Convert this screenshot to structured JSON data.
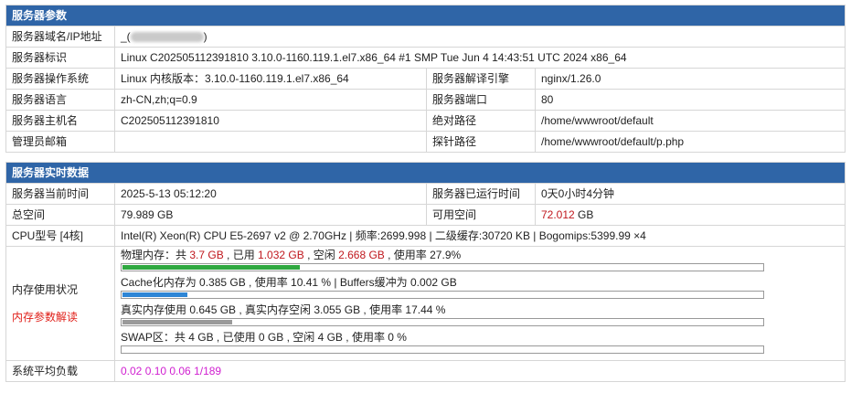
{
  "section1": {
    "title": "服务器参数",
    "rows": {
      "domain": {
        "label": "服务器域名/IP地址",
        "value_prefix": "_(",
        "value_suffix": ")"
      },
      "ident": {
        "label": "服务器标识",
        "value": "Linux C202505112391810 3.10.0-1160.119.1.el7.x86_64 #1 SMP Tue Jun 4 14:43:51 UTC 2024 x86_64"
      },
      "os": {
        "label": "服务器操作系统",
        "value": "Linux  内核版本：3.10.0-1160.119.1.el7.x86_64",
        "label2": "服务器解译引擎",
        "value2": "nginx/1.26.0"
      },
      "lang": {
        "label": "服务器语言",
        "value": "zh-CN,zh;q=0.9",
        "label2": "服务器端口",
        "value2": "80"
      },
      "host": {
        "label": "服务器主机名",
        "value": "C202505112391810",
        "label2": "绝对路径",
        "value2": "/home/wwwroot/default"
      },
      "admin": {
        "label": "管理员邮箱",
        "value": "",
        "label2": "探针路径",
        "value2": "/home/wwwroot/default/p.php"
      }
    }
  },
  "section2": {
    "title": "服务器实时数据",
    "rows": {
      "time": {
        "label": "服务器当前时间",
        "value": "2025-5-13 05:12:20",
        "label2": "服务器已运行时间",
        "value2": "0天0小时4分钟"
      },
      "space": {
        "label": "总空间",
        "value": "79.989 GB",
        "label2": "可用空间",
        "value2_num": "72.012",
        "value2_unit": " GB"
      },
      "cpu": {
        "label": "CPU型号 [4核]",
        "value": "Intel(R) Xeon(R) CPU E5-2697 v2 @ 2.70GHz | 频率:2699.998 | 二级缓存:30720 KB | Bogomips:5399.99 ×4"
      },
      "memory": {
        "label": "内存使用状况",
        "link": "内存参数解读",
        "physical": {
          "text1": "物理内存：共 ",
          "total": "3.7 GB",
          "text2": " , 已用 ",
          "used": "1.032 GB",
          "text3": " , 空闲 ",
          "free": "2.668 GB",
          "text4": " , 使用率 27.9%",
          "percent": 27.9
        },
        "cache": {
          "text": "Cache化内存为 0.385 GB , 使用率 10.41 % | Buffers缓冲为 0.002 GB",
          "percent": 10.41
        },
        "real": {
          "text": "真实内存使用 0.645 GB , 真实内存空闲 3.055 GB , 使用率 17.44 %",
          "percent": 17.44
        },
        "swap": {
          "text": "SWAP区：共 4 GB , 已使用 0 GB , 空闲 4 GB , 使用率 0 %",
          "percent": 0
        }
      },
      "load": {
        "label": "系统平均负载",
        "value": "0.02 0.10 0.06 1/189"
      }
    }
  },
  "colors": {
    "header": "#2f65a7",
    "accent_red": "#c0181e",
    "load_magenta": "#d01fd0",
    "bar_green": "#2fa840",
    "bar_blue": "#2e86d6",
    "bar_gray": "#9a9a9a"
  }
}
